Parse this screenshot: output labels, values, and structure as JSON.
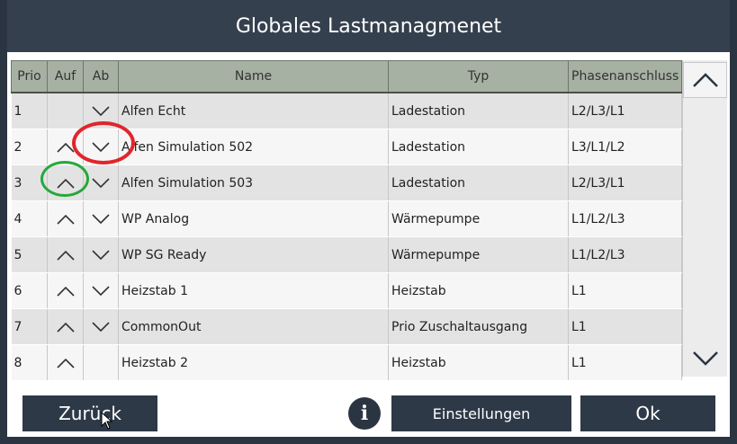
{
  "window": {
    "title": "Globales Lastmanagmenet"
  },
  "table": {
    "headers": {
      "prio": "Prio",
      "auf": "Auf",
      "ab": "Ab",
      "name": "Name",
      "typ": "Typ",
      "phase": "Phasenanschluss"
    },
    "rows": [
      {
        "prio": "1",
        "up": false,
        "down": true,
        "name": "Alfen Echt",
        "typ": "Ladestation",
        "phase": "L2/L3/L1"
      },
      {
        "prio": "2",
        "up": true,
        "down": true,
        "name": "Alfen Simulation 502",
        "typ": "Ladestation",
        "phase": "L3/L1/L2"
      },
      {
        "prio": "3",
        "up": true,
        "down": true,
        "name": "Alfen Simulation 503",
        "typ": "Ladestation",
        "phase": "L2/L3/L1"
      },
      {
        "prio": "4",
        "up": true,
        "down": true,
        "name": "WP Analog",
        "typ": "Wärmepumpe",
        "phase": "L1/L2/L3"
      },
      {
        "prio": "5",
        "up": true,
        "down": true,
        "name": "WP SG Ready",
        "typ": "Wärmepumpe",
        "phase": "L1/L2/L3"
      },
      {
        "prio": "6",
        "up": true,
        "down": true,
        "name": "Heizstab 1",
        "typ": "Heizstab",
        "phase": "L1"
      },
      {
        "prio": "7",
        "up": true,
        "down": true,
        "name": "CommonOut",
        "typ": "Prio Zuschaltausgang",
        "phase": "L1"
      },
      {
        "prio": "8",
        "up": true,
        "down": false,
        "name": "Heizstab 2",
        "typ": "Heizstab",
        "phase": "L1"
      }
    ]
  },
  "footer": {
    "back_label": "Zurück",
    "info_label": "i",
    "settings_label": "Einstellungen",
    "ok_label": "Ok"
  },
  "icons": {
    "row_up": "chevron-up-icon",
    "row_down": "chevron-down-icon",
    "scroll_up": "chevron-up-icon",
    "scroll_down": "chevron-down-icon",
    "info": "info-icon",
    "cursor": "mouse-pointer-icon"
  },
  "colors": {
    "header_bg": "#a6b0a3",
    "chrome": "#2b3542",
    "button_bg": "#2e3947",
    "highlight_red": "#e0262b",
    "highlight_green": "#25a83a"
  }
}
